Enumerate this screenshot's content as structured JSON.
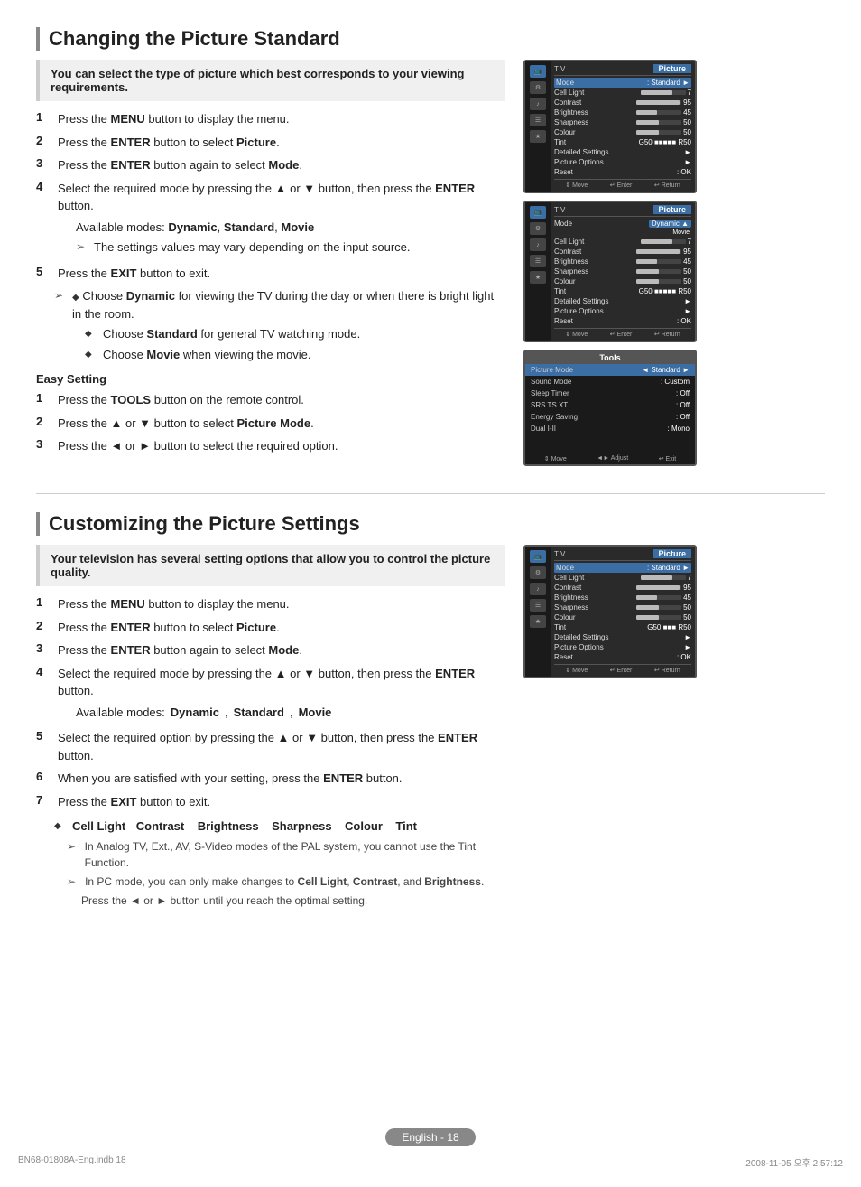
{
  "page": {
    "footer_label": "English - 18",
    "file_info_left": "BN68-01808A-Eng.indb   18",
    "file_info_right": "2008-11-05   오후 2:57:12"
  },
  "section1": {
    "title": "Changing the Picture Standard",
    "intro": "You can select the type of picture which best corresponds to your viewing requirements.",
    "steps": [
      {
        "num": "1",
        "text": "Press the ",
        "bold": "MENU",
        "rest": " button to display the menu."
      },
      {
        "num": "2",
        "text": "Press the ",
        "bold": "ENTER",
        "rest": " button to select ",
        "bold2": "Picture",
        "rest2": "."
      },
      {
        "num": "3",
        "text": "Press the ",
        "bold": "ENTER",
        "rest": " button again to select ",
        "bold2": "Mode",
        "rest2": "."
      },
      {
        "num": "4",
        "text": "Select the required mode by pressing the ▲ or ▼ button, then press the ENTER button.",
        "sub": "Available modes: Dynamic, Standard, Movie",
        "subnote": "The settings values may vary depending on the input source."
      },
      {
        "num": "5",
        "text": "Press the ",
        "bold": "EXIT",
        "rest": " button to exit."
      }
    ],
    "bullets": [
      "Choose Dynamic for viewing the TV during the day or when there is bright light in the room.",
      "Choose Standard for general TV watching mode.",
      "Choose Movie when viewing the movie."
    ],
    "easy_setting": {
      "title": "Easy Setting",
      "steps": [
        {
          "num": "1",
          "text": "Press the TOOLS button on the remote control."
        },
        {
          "num": "2",
          "text": "Press the ▲ or ▼ button to select Picture Mode."
        },
        {
          "num": "3",
          "text": "Press the ◄ or ► button to select the required option."
        }
      ]
    }
  },
  "section2": {
    "title": "Customizing the Picture Settings",
    "intro": "Your television has several setting options that allow you to control the picture quality.",
    "steps": [
      {
        "num": "1",
        "text": "Press the MENU button to display the menu."
      },
      {
        "num": "2",
        "text": "Press the ENTER button to select Picture."
      },
      {
        "num": "3",
        "text": "Press the ENTER button again to select Mode."
      },
      {
        "num": "4",
        "text": "Select the required mode by pressing the ▲ or ▼ button, then press the ENTER button.",
        "sub": "Available modes: Dynamic, Standard, Movie"
      },
      {
        "num": "5",
        "text": "Select the required option by pressing the ▲ or ▼ button, then press the ENTER button."
      },
      {
        "num": "6",
        "text": "When you are satisfied with your setting, press the ENTER button."
      },
      {
        "num": "7",
        "text": "Press the EXIT button to exit."
      }
    ],
    "note": {
      "bullet": "Cell Light - Contrast – Brightness – Sharpness – Colour – Tint",
      "sub1": "In Analog TV, Ext., AV, S-Video modes of the PAL system, you cannot use the Tint Function.",
      "sub2": "In PC mode, you can only make changes to Cell Light, Contrast, and Brightness.",
      "sub3": "Press the ◄ or ► button until you reach the optimal setting."
    }
  },
  "tv_screens": {
    "screen1": {
      "menu_label": "T V",
      "menu_title": "Picture",
      "mode_label": "Mode",
      "mode_value": ": Standard",
      "cell_light": "Cell Light",
      "contrast": "Contrast",
      "brightness": "Brightness",
      "sharpness": "Sharpness",
      "colour": "Colour",
      "tint_label": "Tint",
      "tint_g": "G50",
      "tint_r": "R50",
      "detailed": "Detailed Settings",
      "picture_options": "Picture Options",
      "reset": "Reset",
      "reset_value": ": OK",
      "values": {
        "contrast": 95,
        "brightness": 45,
        "sharpness": 50,
        "colour": 50,
        "cell_light": 7
      }
    },
    "screen2": {
      "mode_dropdown": "Dynamic",
      "mode2": "Movie",
      "cell_light": 7,
      "contrast": 95,
      "brightness": 45,
      "sharpness": 50,
      "colour": 50
    },
    "screen3_tools": {
      "title": "Tools",
      "picture_mode_label": "Picture Mode",
      "picture_mode_value": "Standard",
      "sound_mode": "Sound Mode",
      "sound_value": ": Custom",
      "sleep_timer": "Sleep Timer",
      "sleep_value": ": Off",
      "srs": "SRS TS XT",
      "srs_value": ": Off",
      "energy": "Energy Saving",
      "energy_value": ": Off",
      "dual": "Dual I-II",
      "dual_value": ": Mono"
    },
    "screen4": {
      "mode_value": ": Standard",
      "cell_light": 7,
      "contrast": 95,
      "brightness": 45,
      "sharpness": 50,
      "colour": 50
    }
  }
}
